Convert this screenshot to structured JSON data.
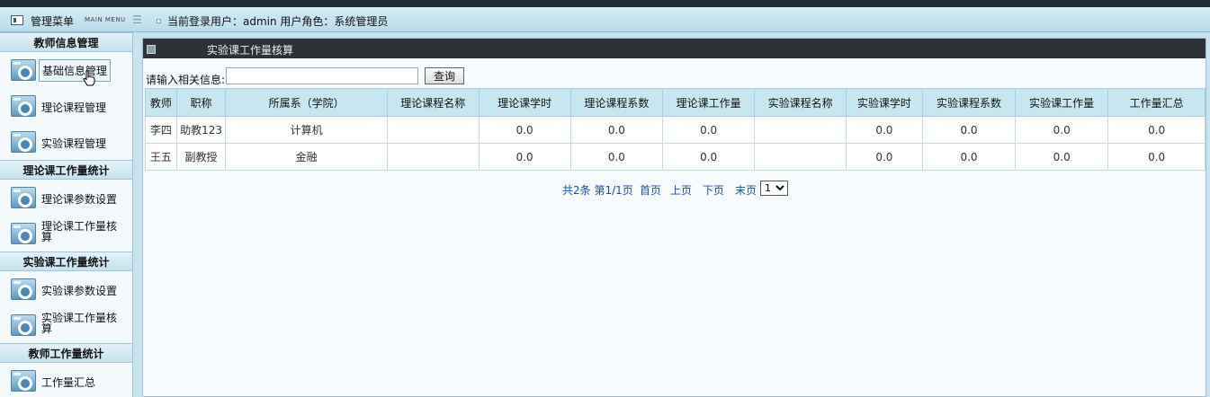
{
  "header": {
    "menu_title": "管理菜单",
    "menu_subtitle": "MAIN MENU",
    "user_info": "当前登录用户：admin 用户角色：系统管理员"
  },
  "sidebar": {
    "sections": [
      {
        "title": "教师信息管理",
        "items": [
          {
            "label": "基础信息管理",
            "icon": "gear-icon",
            "active": true
          },
          {
            "label": "理论课程管理",
            "icon": "gear-icon"
          },
          {
            "label": "实验课程管理",
            "icon": "gear-icon"
          }
        ]
      },
      {
        "title": "理论课工作量统计",
        "items": [
          {
            "label": "理论课参数设置",
            "icon": "gear-icon"
          },
          {
            "label": "理论课工作量核算",
            "icon": "gear-icon"
          }
        ]
      },
      {
        "title": "实验课工作量统计",
        "items": [
          {
            "label": "实验课参数设置",
            "icon": "gear-icon"
          },
          {
            "label": "实验课工作量核算",
            "icon": "gear-icon"
          }
        ]
      },
      {
        "title": "教师工作量统计",
        "items": [
          {
            "label": "工作量汇总",
            "icon": "gear-icon"
          }
        ]
      }
    ]
  },
  "main": {
    "title": "实验课工作量核算",
    "search": {
      "label": "请输入相关信息:",
      "value": "",
      "button": "查询"
    },
    "table": {
      "columns": [
        "教师",
        "职称",
        "所属系（学院）",
        "理论课程名称",
        "理论课学时",
        "理论课程系数",
        "理论课工作量",
        "实验课程名称",
        "实验课学时",
        "实验课程系数",
        "实验课工作量",
        "工作量汇总"
      ],
      "rows": [
        [
          "李四",
          "助教123",
          "计算机",
          "",
          "0.0",
          "0.0",
          "0.0",
          "",
          "0.0",
          "0.0",
          "0.0",
          "0.0"
        ],
        [
          "王五",
          "副教授",
          "金融",
          "",
          "0.0",
          "0.0",
          "0.0",
          "",
          "0.0",
          "0.0",
          "0.0",
          "0.0"
        ]
      ]
    },
    "pager": {
      "summary": "共2条 第1/1页",
      "first": "首页",
      "prev": "上页",
      "next": "下页",
      "last": "末页",
      "page_select": "1"
    }
  }
}
